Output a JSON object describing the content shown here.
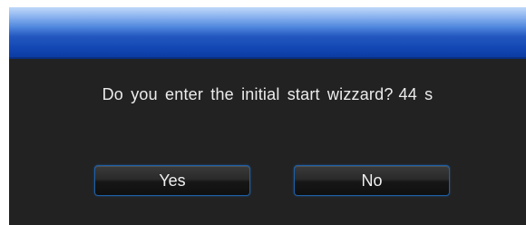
{
  "dialog": {
    "message": "Do you enter the initial start wizzard?",
    "countdown": "44 s",
    "buttons": {
      "yes_label": "Yes",
      "no_label": "No"
    }
  },
  "colors": {
    "background": "#222222",
    "title_bar": "#1448b4",
    "button_border": "#1e60a8",
    "text": "#ececec"
  }
}
